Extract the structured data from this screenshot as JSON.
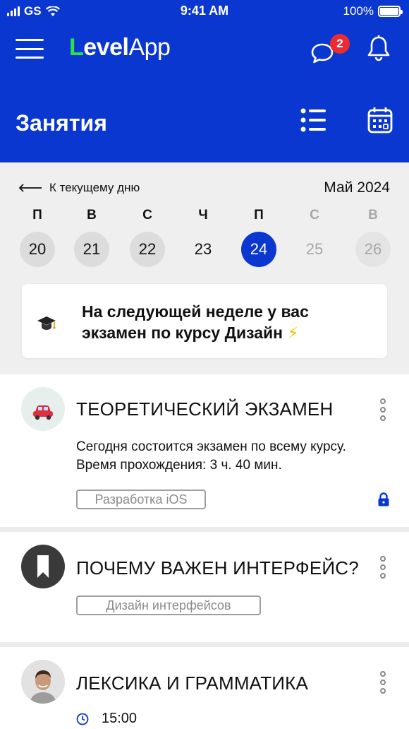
{
  "status_bar": {
    "carrier": "GS",
    "time": "9:41 AM",
    "battery": "100%"
  },
  "app": {
    "logo_bold": "Level",
    "logo_light": "App",
    "chat_badge": "2"
  },
  "page": {
    "title": "Занятия"
  },
  "calendar": {
    "back_label": "К текущему дню",
    "month": "Май 2024",
    "weekdays": [
      "П",
      "В",
      "С",
      "Ч",
      "П",
      "С",
      "В"
    ],
    "dates": [
      "20",
      "21",
      "22",
      "23",
      "24",
      "25",
      "26"
    ],
    "selected_date": "24"
  },
  "notice": {
    "text": "На следующей неделе у вас экзамен по курсу Дизайн",
    "emoji": "⚡"
  },
  "lessons": [
    {
      "title": "ТЕОРЕТИЧЕСКИЙ ЭКЗАМЕН",
      "description": "Сегодня состоится экзамен по всему курсу. Время прохождения: 3 ч. 40 мин.",
      "tag": "Разработка iOS",
      "icon": "car-icon",
      "locked": true
    },
    {
      "title": "ПОЧЕМУ ВАЖЕН ИНТЕРФЕЙС?",
      "tag": "Дизайн интерфейсов",
      "icon": "bookmark-icon"
    },
    {
      "title": "ЛЕКСИКА И ГРАММАТИКА",
      "time": "15:00",
      "icon": "teacher-avatar"
    }
  ],
  "colors": {
    "brand": "#0a37cf",
    "logo_accent": "#2ee04a",
    "badge": "#ea2b31"
  }
}
